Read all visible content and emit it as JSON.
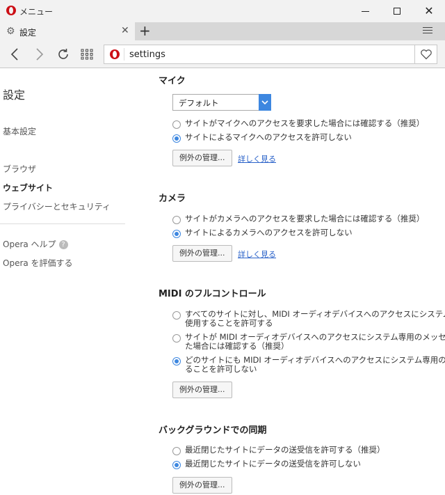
{
  "window": {
    "menu_label": "メニュー",
    "minimize_label": "minimize",
    "maximize_label": "maximize",
    "close_label": "close"
  },
  "tab": {
    "title": "設定",
    "close_glyph": "✕",
    "new_tab_glyph": "+"
  },
  "address": {
    "url": "settings"
  },
  "sidebar": {
    "title": "設定",
    "items": [
      {
        "label": "基本設定"
      },
      {
        "label": "ブラウザ"
      },
      {
        "label": "ウェブサイト"
      },
      {
        "label": "プライバシーとセキュリティ"
      },
      {
        "label": "Opera ヘルプ"
      },
      {
        "label": "Opera を評価する"
      }
    ],
    "help_glyph": "?"
  },
  "sections": {
    "mic": {
      "title": "マイク",
      "select_value": "デフォルト",
      "options": [
        {
          "label": "サイトがマイクへのアクセスを要求した場合には確認する（推奨）",
          "checked": false
        },
        {
          "label": "サイトによるマイクへのアクセスを許可しない",
          "checked": true
        }
      ],
      "manage_label": "例外の管理...",
      "learn_label": "詳しく見る"
    },
    "camera": {
      "title": "カメラ",
      "options": [
        {
          "label": "サイトがカメラへのアクセスを要求した場合には確認する（推奨）",
          "checked": false
        },
        {
          "label": "サイトによるカメラへのアクセスを許可しない",
          "checked": true
        }
      ],
      "manage_label": "例外の管理...",
      "learn_label": "詳しく見る"
    },
    "midi": {
      "title": "MIDI のフルコントロール",
      "options": [
        {
          "line1": "すべてのサイトに対し、MIDI オーディオデバイスへのアクセスにシステム専用のメッセージを",
          "line2": "使用することを許可する",
          "checked": false
        },
        {
          "line1": "サイトが MIDI オーディオデバイスへのアクセスにシステム専用のメッセージの使用を要求し",
          "line2": "た場合には確認する（推奨）",
          "checked": false
        },
        {
          "line1": "どのサイトにも MIDI オーディオデバイスへのアクセスにシステム専用のメッセージを使用す",
          "line2": "ることを許可しない",
          "checked": true
        }
      ],
      "manage_label": "例外の管理..."
    },
    "background": {
      "title": "バックグラウンドでの同期",
      "options": [
        {
          "label": "最近閉じたサイトにデータの送受信を許可する（推奨）",
          "checked": false
        },
        {
          "label": "最近閉じたサイトにデータの送受信を許可しない",
          "checked": true
        }
      ],
      "manage_label": "例外の管理..."
    }
  },
  "colors": {
    "accent": "#3d87e0",
    "link": "#2a62c9",
    "brand": "#cc0f16"
  }
}
